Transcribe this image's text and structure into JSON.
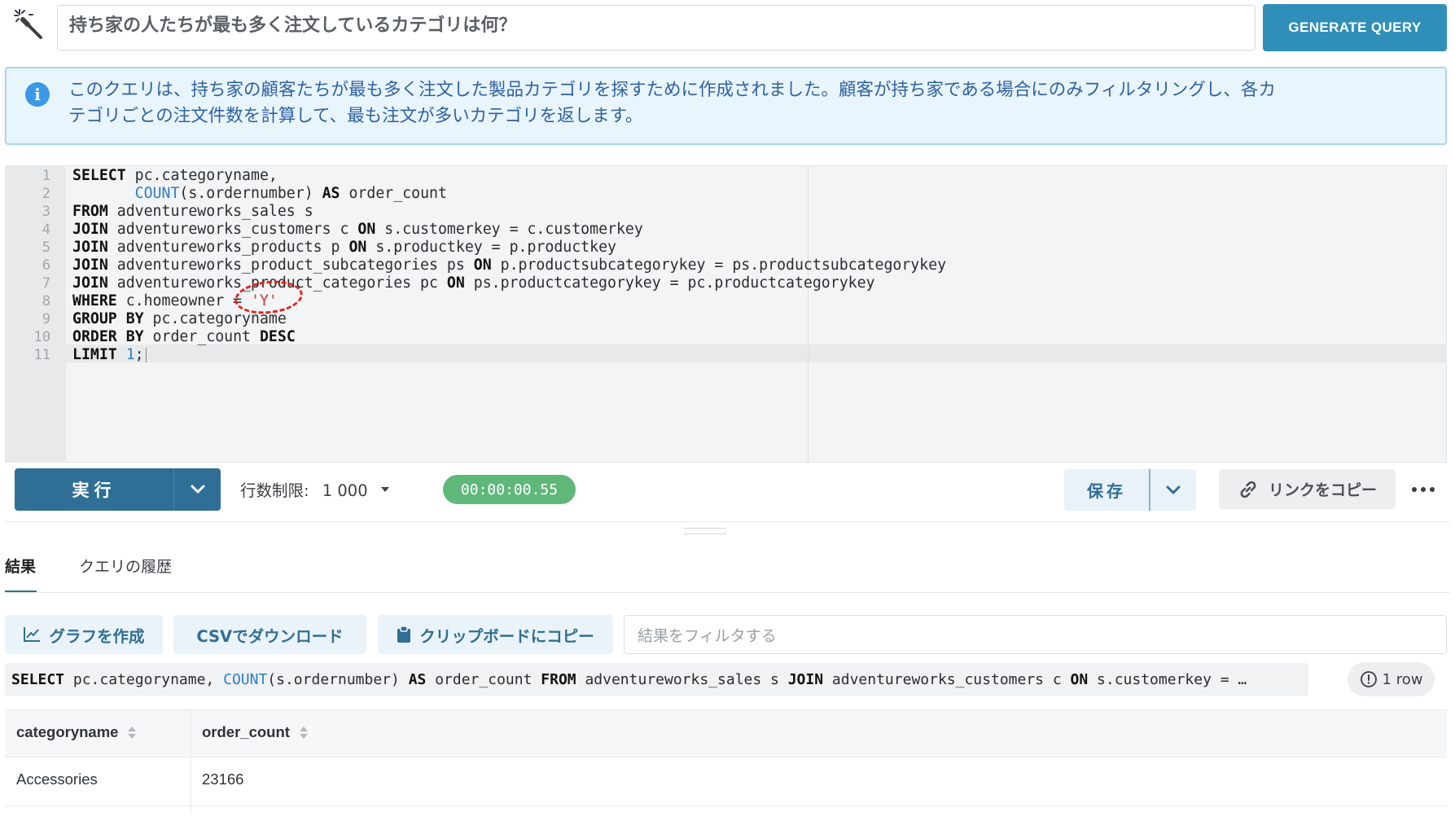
{
  "question": {
    "value": "持ち家の人たちが最も多く注文しているカテゴリは何？",
    "generate_label": "GENERATE QUERY"
  },
  "info": {
    "line1": "このクエリは、持ち家の顧客たちが最も多く注文した製品カテゴリを探すために作成されました。顧客が持ち家である場合にのみフィルタリングし、各カ",
    "line2": "テゴリごとの注文件数を計算して、最も注文が多いカテゴリを返します。"
  },
  "editor": {
    "line_numbers": [
      "1",
      "2",
      "3",
      "4",
      "5",
      "6",
      "7",
      "8",
      "9",
      "10",
      "11"
    ],
    "active_line": "11"
  },
  "toolbar": {
    "run_label": "実行",
    "limit_label": "行数制限:",
    "limit_value": "1 000",
    "timer": "00:00:00.55",
    "save_label": "保存",
    "copy_link_label": "リンクをコピー"
  },
  "tabs": {
    "results": "結果",
    "history": "クエリの履歴"
  },
  "actions": {
    "chart": "グラフを作成",
    "csv": "CSVでダウンロード",
    "clipboard": "クリップボードにコピー",
    "filter_placeholder": "結果をフィルタする"
  },
  "summary": {
    "rows": "1 row"
  },
  "table": {
    "columns": [
      "categoryname",
      "order_count"
    ],
    "rows": [
      [
        "Accessories",
        "23166"
      ]
    ]
  },
  "colors": {
    "primary": "#2f6f95",
    "accent": "#2f8fb9",
    "timer_green": "#5fb87a",
    "info_bg": "#e9f5fd"
  },
  "icons": {
    "wand": "magic-wand-icon",
    "info": "info-icon",
    "link": "link-icon",
    "chart": "line-chart-icon",
    "clipboard": "clipboard-icon",
    "rows": "info-circle-icon"
  }
}
